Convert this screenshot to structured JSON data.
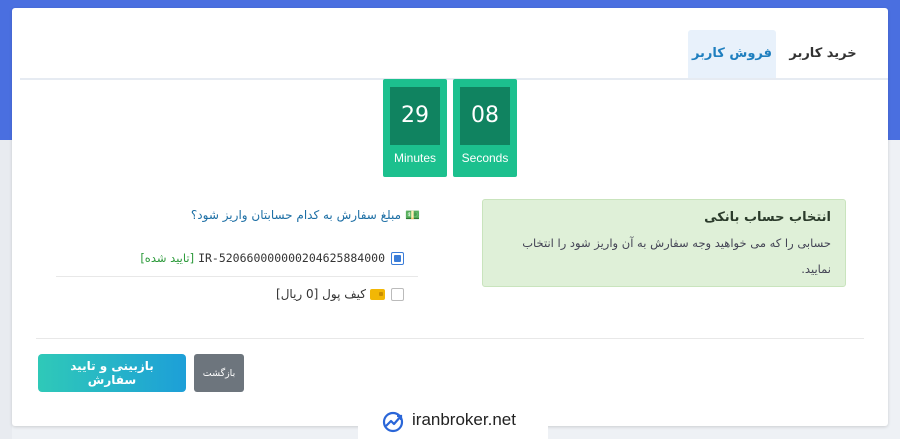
{
  "tabs": {
    "buy_label": "خرید کاربر",
    "sell_label": "فروش کاربر",
    "active": "sell"
  },
  "timer": {
    "minutes_value": "29",
    "minutes_label": "Minutes",
    "seconds_value": "08",
    "seconds_label": "Seconds"
  },
  "alert": {
    "title": "انتخاب حساب بانکی",
    "body": "حسابی را که می خواهید وجه سفارش به آن واریز شود را انتخاب نمایید."
  },
  "account_select": {
    "question_icon": "cash-icon",
    "question": "مبلغ سفارش به کدام حسابتان واریز شود؟",
    "options": [
      {
        "iban": "IR-520660000000204625884000",
        "status": "[تایید شده]",
        "checked": true
      },
      {
        "label": "کیف پول [0 ریال]",
        "icon": "wallet-icon",
        "checked": false
      }
    ]
  },
  "actions": {
    "review_label": "بازبینی و تایید سفارش",
    "back_label": "بازگشت"
  },
  "watermark": {
    "text": "iranbroker.net"
  },
  "colors": {
    "timer_bg": "#1cc08e",
    "timer_inner": "#108360",
    "alert_bg": "#dff0d8",
    "link": "#1d6fa5",
    "verified": "#2e9b3c",
    "back_button": "#6d757d",
    "primary_gradient_start": "#2fc9b8",
    "primary_gradient_end": "#1d9fd8",
    "header_bg": "#4a6fe0"
  }
}
